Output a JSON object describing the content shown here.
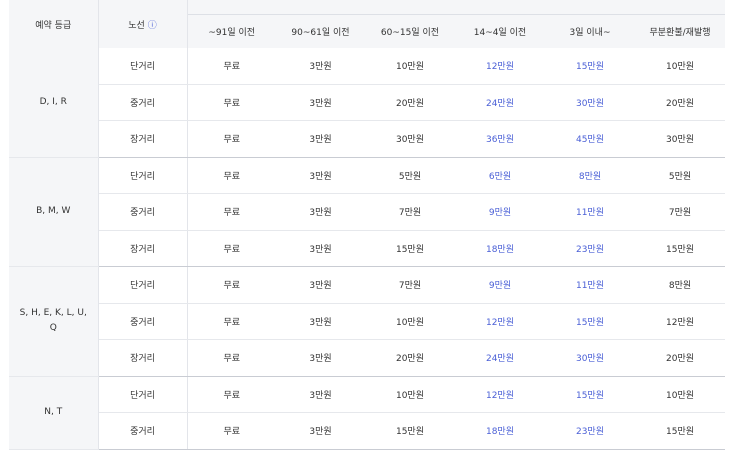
{
  "header": {
    "grade": "예약 등급",
    "route": "노선",
    "route_icon": "info-icon",
    "route_icon_glyph": "ⓘ",
    "periods": [
      "~91일 이전",
      "90~61일 이전",
      "60~15일 이전",
      "14~4일 이전",
      "3일 이내~",
      "무분환불/재발행"
    ]
  },
  "colors": {
    "highlight": "#4a5fd6",
    "header_bg": "#f5f6f8"
  },
  "groups": [
    {
      "grade": "D, I, R",
      "rows": [
        {
          "route": "단거리",
          "v": [
            "무료",
            "3만원",
            "10만원",
            "12만원",
            "15만원",
            "10만원"
          ]
        },
        {
          "route": "중거리",
          "v": [
            "무료",
            "3만원",
            "20만원",
            "24만원",
            "30만원",
            "20만원"
          ]
        },
        {
          "route": "장거리",
          "v": [
            "무료",
            "3만원",
            "30만원",
            "36만원",
            "45만원",
            "30만원"
          ]
        }
      ]
    },
    {
      "grade": "B, M, W",
      "rows": [
        {
          "route": "단거리",
          "v": [
            "무료",
            "3만원",
            "5만원",
            "6만원",
            "8만원",
            "5만원"
          ]
        },
        {
          "route": "중거리",
          "v": [
            "무료",
            "3만원",
            "7만원",
            "9만원",
            "11만원",
            "7만원"
          ]
        },
        {
          "route": "장거리",
          "v": [
            "무료",
            "3만원",
            "15만원",
            "18만원",
            "23만원",
            "15만원"
          ]
        }
      ]
    },
    {
      "grade": "S, H, E, K, L, U, Q",
      "rows": [
        {
          "route": "단거리",
          "v": [
            "무료",
            "3만원",
            "7만원",
            "9만원",
            "11만원",
            "8만원"
          ]
        },
        {
          "route": "중거리",
          "v": [
            "무료",
            "3만원",
            "10만원",
            "12만원",
            "15만원",
            "12만원"
          ]
        },
        {
          "route": "장거리",
          "v": [
            "무료",
            "3만원",
            "20만원",
            "24만원",
            "30만원",
            "20만원"
          ]
        }
      ]
    },
    {
      "grade": "N, T",
      "rows": [
        {
          "route": "단거리",
          "v": [
            "무료",
            "3만원",
            "10만원",
            "12만원",
            "15만원",
            "10만원"
          ]
        },
        {
          "route": "중거리",
          "v": [
            "무료",
            "3만원",
            "15만원",
            "18만원",
            "23만원",
            "15만원"
          ]
        }
      ]
    }
  ]
}
